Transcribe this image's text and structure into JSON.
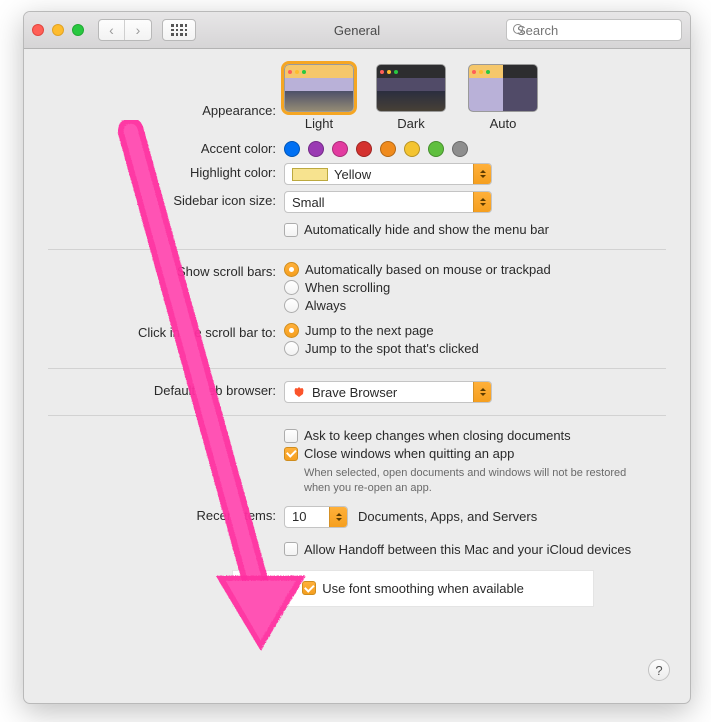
{
  "window": {
    "title": "General",
    "search_placeholder": "Search"
  },
  "appearance": {
    "label": "Appearance:",
    "options": [
      {
        "id": "light",
        "label": "Light",
        "selected": true
      },
      {
        "id": "dark",
        "label": "Dark",
        "selected": false
      },
      {
        "id": "auto",
        "label": "Auto",
        "selected": false
      }
    ]
  },
  "accent": {
    "label": "Accent color:",
    "colors": [
      "#0070f3",
      "#9a3ab3",
      "#e23ba0",
      "#d4322f",
      "#f08b1d",
      "#f4c431",
      "#5fbf3e",
      "#8e8e8e"
    ]
  },
  "highlight": {
    "label": "Highlight color:",
    "value": "Yellow"
  },
  "sidebar_size": {
    "label": "Sidebar icon size:",
    "value": "Small"
  },
  "auto_hide_menubar": {
    "label": "Automatically hide and show the menu bar",
    "checked": false
  },
  "scrollbars": {
    "label": "Show scroll bars:",
    "options": [
      {
        "label": "Automatically based on mouse or trackpad",
        "selected": true
      },
      {
        "label": "When scrolling",
        "selected": false
      },
      {
        "label": "Always",
        "selected": false
      }
    ]
  },
  "click_scrollbar": {
    "label": "Click in the scroll bar to:",
    "options": [
      {
        "label": "Jump to the next page",
        "selected": true
      },
      {
        "label": "Jump to the spot that's clicked",
        "selected": false
      }
    ]
  },
  "default_browser": {
    "label": "Default web browser:",
    "value": "Brave Browser"
  },
  "ask_keep_changes": {
    "label": "Ask to keep changes when closing documents",
    "checked": false
  },
  "close_windows": {
    "label": "Close windows when quitting an app",
    "checked": true,
    "note": "When selected, open documents and windows will not be restored when you re-open an app."
  },
  "recent_items": {
    "label": "Recent items:",
    "value": "10",
    "suffix": "Documents, Apps, and Servers"
  },
  "handoff": {
    "label": "Allow Handoff between this Mac and your iCloud devices",
    "checked": false
  },
  "font_smoothing": {
    "label": "Use font smoothing when available",
    "checked": true
  },
  "help": "?"
}
